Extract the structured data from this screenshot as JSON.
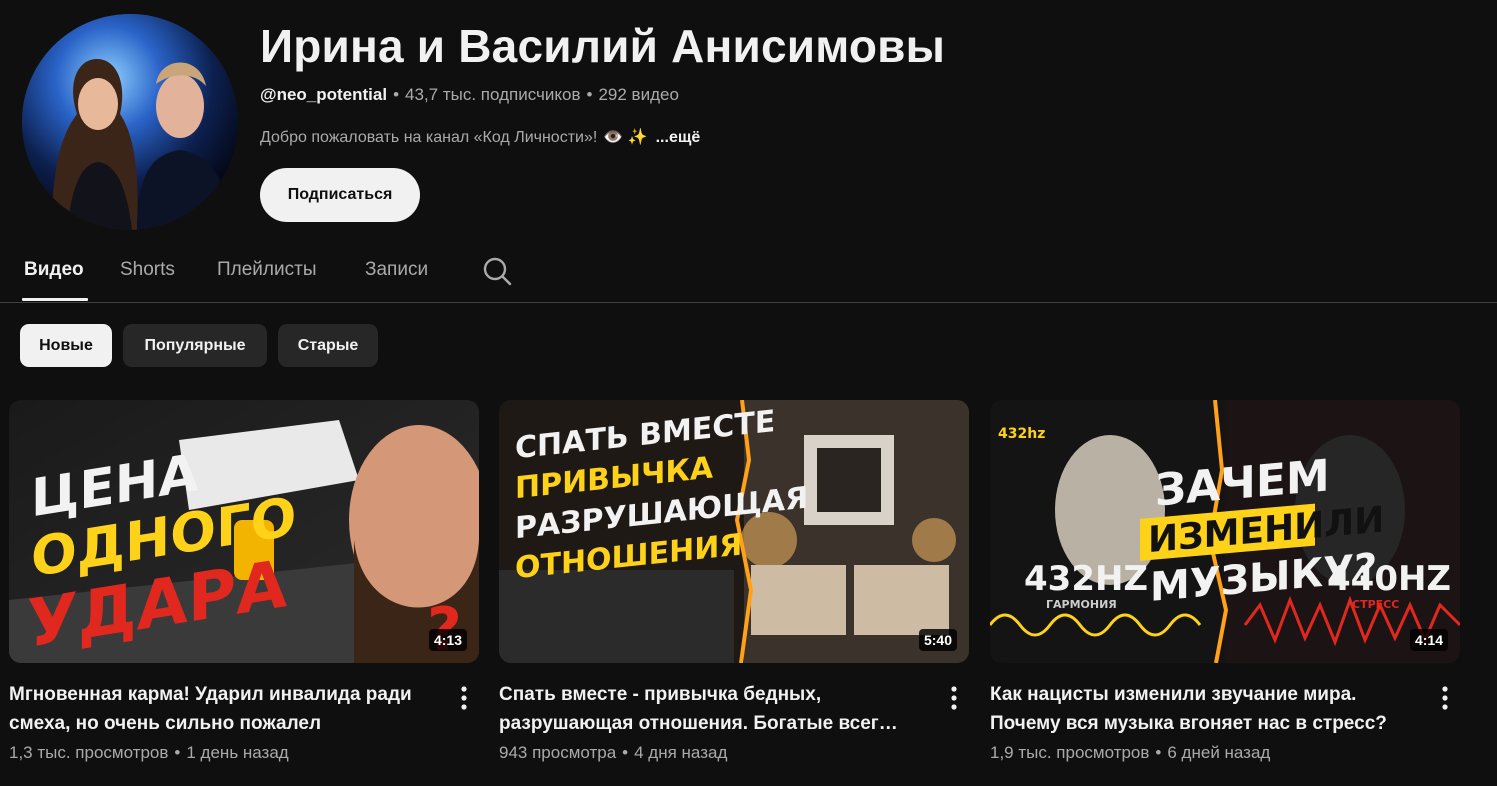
{
  "channel": {
    "title": "Ирина и Василий Анисимовы",
    "handle": "@neo_potential",
    "subscribers": "43,7 тыс. подписчиков",
    "video_count": "292 видео",
    "description": "Добро пожаловать на канал «Код Личности»!",
    "description_emojis": "👁️ ✨",
    "more_label": "...ещё",
    "subscribe_label": "Подписаться"
  },
  "tabs": [
    {
      "label": "Видео",
      "active": true
    },
    {
      "label": "Shorts",
      "active": false
    },
    {
      "label": "Плейлисты",
      "active": false
    },
    {
      "label": "Записи",
      "active": false
    }
  ],
  "search_icon": "search-icon",
  "chips": [
    {
      "label": "Новые",
      "selected": true
    },
    {
      "label": "Популярные",
      "selected": false
    },
    {
      "label": "Старые",
      "selected": false
    }
  ],
  "videos": [
    {
      "title": "Мгновенная карма! Ударил инвалида ради смеха, но очень сильно пожалел",
      "duration": "4:13",
      "views": "1,3 тыс. просмотров",
      "age": "1 день назад",
      "thumb_text": [
        "ЦЕНА",
        "ОДНОГО",
        "УДАРА",
        "?"
      ]
    },
    {
      "title": "Спать вместе - привычка бедных, разрушающая отношения. Богатые всег…",
      "duration": "5:40",
      "views": "943 просмотра",
      "age": "4 дня назад",
      "thumb_text": [
        "СПАТЬ ВМЕСТЕ",
        "ПРИВЫЧКА",
        "РАЗРУШАЮЩАЯ",
        "ОТНОШЕНИЯ"
      ]
    },
    {
      "title": "Как нацисты изменили звучание мира. Почему вся музыка вгоняет нас в стресс?",
      "duration": "4:14",
      "views": "1,9 тыс. просмотров",
      "age": "6 дней назад",
      "thumb_text": [
        "ЗАЧЕМ",
        "ИЗМЕНИЛИ",
        "МУЗЫКУ?",
        "432HZ",
        "ГАРМОНИЯ",
        "440HZ",
        "СТРЕСС",
        "432hz"
      ]
    }
  ],
  "colors": {
    "background": "#0f0f0f",
    "text_primary": "#f1f1f1",
    "text_secondary": "#aaaaaa",
    "chip_bg": "#272727",
    "thumb_yellow": "#ffd21a",
    "thumb_red": "#e0281e"
  }
}
